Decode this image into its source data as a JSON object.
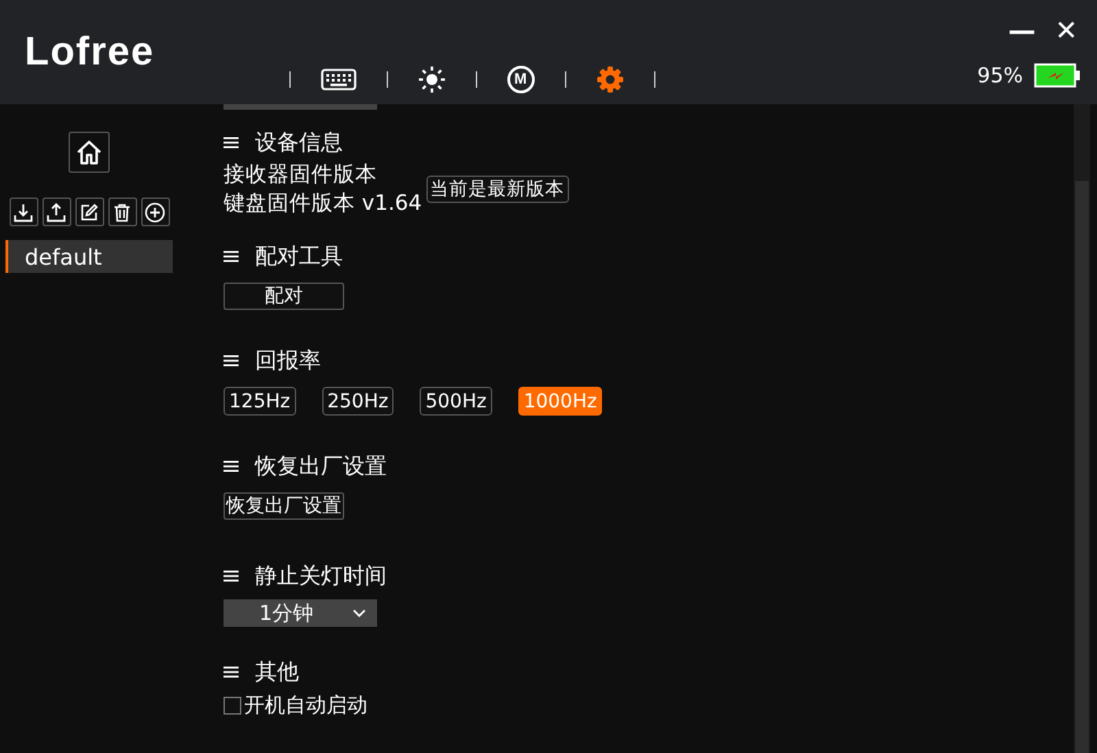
{
  "logo": "Lofree",
  "tabs": [
    {
      "kind": "keyboard",
      "selected": false
    },
    {
      "kind": "brightness",
      "selected": false
    },
    {
      "kind": "macro",
      "label": "M",
      "selected": false
    },
    {
      "kind": "settings",
      "selected": true
    }
  ],
  "window_controls": [
    "—",
    "✕"
  ],
  "battery": {
    "percent": "95%"
  },
  "sidebar": {
    "profiles": [
      {
        "label": "default",
        "selected": true
      }
    ]
  },
  "sections": [
    {
      "kind": "info",
      "title": "设备信息",
      "lines": [
        "接收器固件版本",
        "键盘固件版本 v1.64"
      ],
      "button": "当前是最新版本"
    },
    {
      "kind": "button",
      "title": "配对工具",
      "button": "配对"
    },
    {
      "kind": "options",
      "title": "回报率",
      "options": [
        {
          "label": "125Hz",
          "selected": false
        },
        {
          "label": "250Hz",
          "selected": false
        },
        {
          "label": "500Hz",
          "selected": false
        },
        {
          "label": "1000Hz",
          "selected": true
        }
      ]
    },
    {
      "kind": "button",
      "title": "恢复出厂设置",
      "button": "恢复出厂设置"
    },
    {
      "kind": "select",
      "title": "静止关灯时间",
      "value": "1分钟"
    },
    {
      "kind": "checkbox",
      "title": "其他",
      "label": "开机自动启动",
      "checked": false
    }
  ]
}
